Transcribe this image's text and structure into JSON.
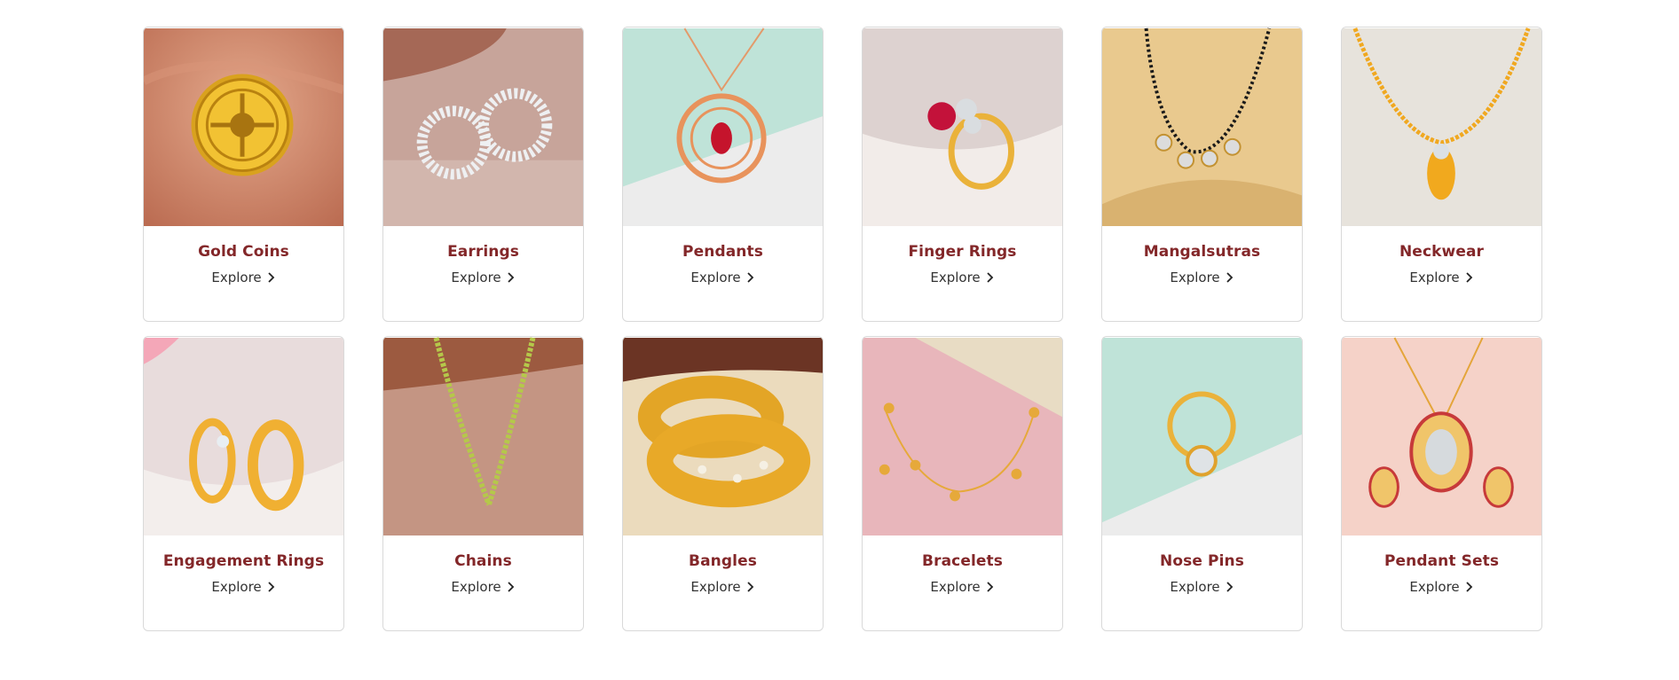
{
  "explore_label": "Explore",
  "accent_color": "#832729",
  "categories": [
    {
      "title": "Gold Coins",
      "icon": "gold-coin-image"
    },
    {
      "title": "Earrings",
      "icon": "earrings-image"
    },
    {
      "title": "Pendants",
      "icon": "pendant-image"
    },
    {
      "title": "Finger Rings",
      "icon": "finger-ring-image"
    },
    {
      "title": "Mangalsutras",
      "icon": "mangalsutra-image"
    },
    {
      "title": "Neckwear",
      "icon": "neckwear-image"
    },
    {
      "title": "Engagement Rings",
      "icon": "engagement-rings-image"
    },
    {
      "title": "Chains",
      "icon": "chain-image"
    },
    {
      "title": "Bangles",
      "icon": "bangles-image"
    },
    {
      "title": "Bracelets",
      "icon": "bracelet-image"
    },
    {
      "title": "Nose Pins",
      "icon": "nose-pin-image"
    },
    {
      "title": "Pendant Sets",
      "icon": "pendant-set-image"
    }
  ]
}
